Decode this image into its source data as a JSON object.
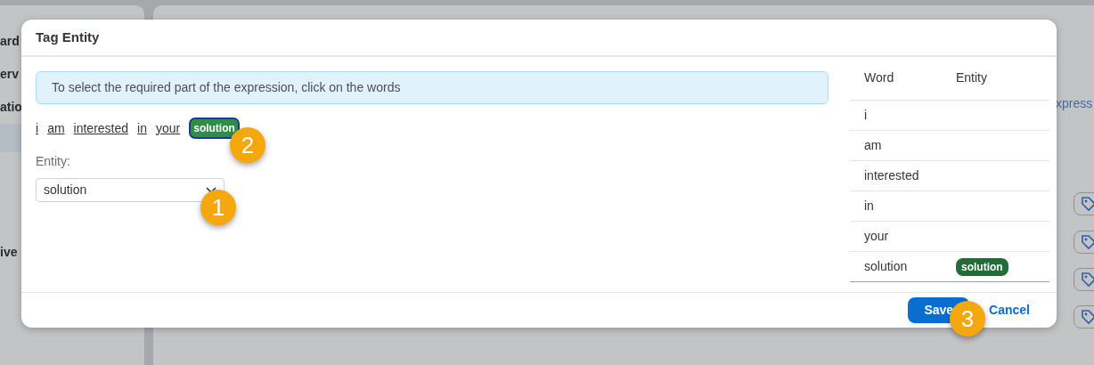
{
  "background": {
    "sidebar_items": [
      {
        "label": "ard",
        "selected": false
      },
      {
        "label": "erv",
        "selected": false
      },
      {
        "label": "atio",
        "selected": false
      },
      {
        "selected": true
      },
      {
        "label": "ive",
        "selected": false
      }
    ],
    "link_text": "xpress"
  },
  "dialog": {
    "title": "Tag Entity",
    "hint": "To select the required part of the expression, click on the words",
    "tokens": [
      {
        "text": "i",
        "selected": false
      },
      {
        "text": "am",
        "selected": false
      },
      {
        "text": "interested",
        "selected": false
      },
      {
        "text": "in",
        "selected": false
      },
      {
        "text": "your",
        "selected": false
      },
      {
        "text": "solution",
        "selected": true
      }
    ],
    "entity_label": "Entity:",
    "entity_value": "solution",
    "table": {
      "columns": [
        "Word",
        "Entity"
      ],
      "rows": [
        {
          "word": "i"
        },
        {
          "word": "am"
        },
        {
          "word": "interested"
        },
        {
          "word": "in"
        },
        {
          "word": "your"
        },
        {
          "word": "solution",
          "entity": "solution"
        }
      ]
    },
    "buttons": [
      {
        "label": "Save",
        "kind": "primary"
      },
      {
        "label": "Cancel",
        "kind": "link"
      }
    ]
  },
  "callouts": [
    "1",
    "2",
    "3"
  ]
}
